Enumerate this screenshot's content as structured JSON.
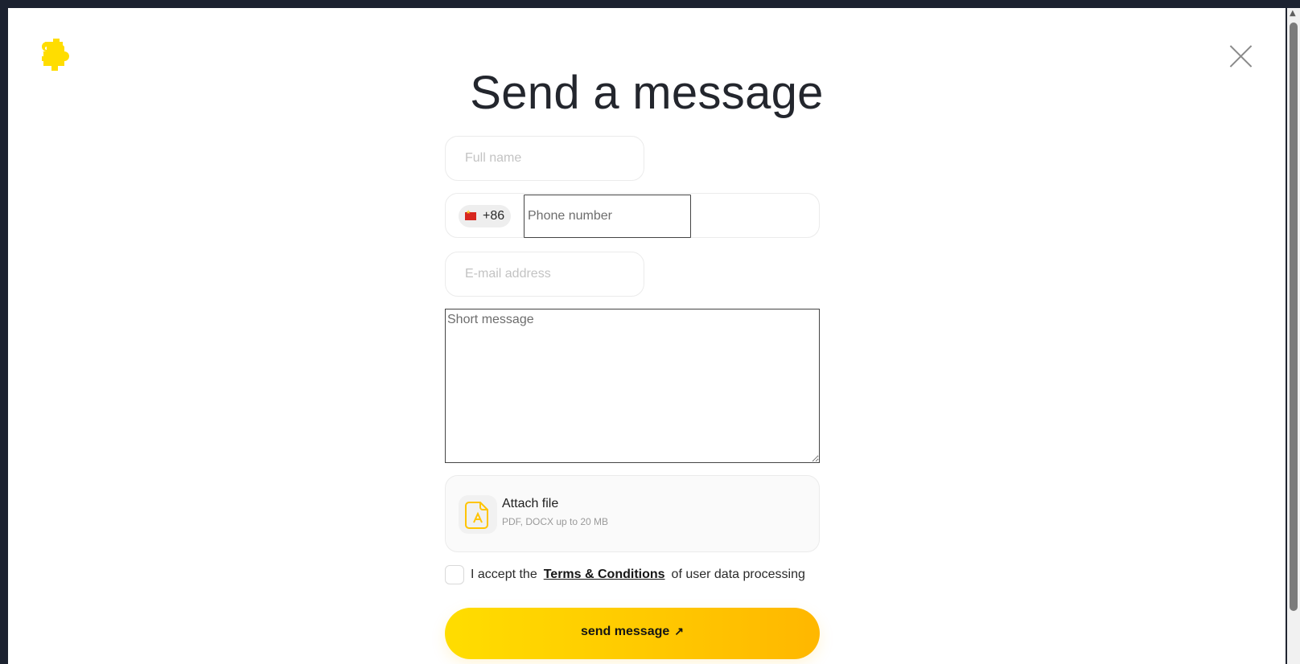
{
  "modal": {
    "title": "Send a message",
    "close_icon": "close-icon",
    "logo_icon": "brand-logo-icon"
  },
  "form": {
    "full_name": {
      "placeholder": "Full name",
      "value": ""
    },
    "phone": {
      "dial_code": "+86",
      "flag_icon": "china-flag-icon",
      "placeholder": "Phone number",
      "value": ""
    },
    "email": {
      "placeholder": "E-mail address",
      "value": ""
    },
    "message": {
      "placeholder": "Short message",
      "value": ""
    },
    "attach": {
      "title": "Attach file",
      "subtitle": "PDF, DOCX up to 20 MB",
      "icon": "document-icon"
    },
    "consent": {
      "prefix": "I accept the",
      "link": "Terms & Conditions",
      "suffix": "of user data processing",
      "checked": false
    },
    "submit": {
      "label": "send message",
      "icon": "arrow-up-right-icon"
    }
  },
  "colors": {
    "brand_yellow": "#FFDD00",
    "brand_orange": "#FFB700",
    "title_text": "#23262D",
    "field_border": "#EBEBEB"
  }
}
